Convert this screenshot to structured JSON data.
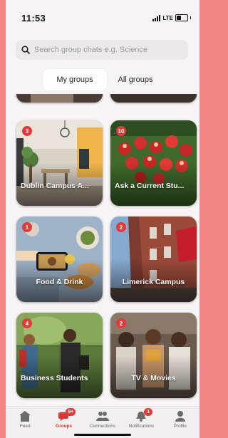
{
  "status_bar": {
    "time": "11:53",
    "network": "LTE"
  },
  "search": {
    "placeholder": "Search group chats e.g. Science"
  },
  "segments": {
    "my_groups": "My groups",
    "all_groups": "All groups"
  },
  "groups": [
    {
      "title": "Dublin Campus A...",
      "badge": "3"
    },
    {
      "title": "Ask a Current Stu...",
      "badge": "10"
    },
    {
      "title": "Food & Drink",
      "badge": "1"
    },
    {
      "title": "Limerick Campus",
      "badge": "2"
    },
    {
      "title": "Business Students",
      "badge": "4"
    },
    {
      "title": "TV & Movies",
      "badge": "2"
    }
  ],
  "tabbar": {
    "items": [
      {
        "label": "Feed",
        "icon": "home-icon"
      },
      {
        "label": "Groups",
        "icon": "groups-chat-icon",
        "badge": "9+"
      },
      {
        "label": "Connections",
        "icon": "connections-icon"
      },
      {
        "label": "Notifications",
        "icon": "bell-icon",
        "badge": "1"
      },
      {
        "label": "Profile",
        "icon": "profile-icon"
      }
    ]
  },
  "colors": {
    "accent": "#e03a3a",
    "page_frame": "#f48585"
  }
}
